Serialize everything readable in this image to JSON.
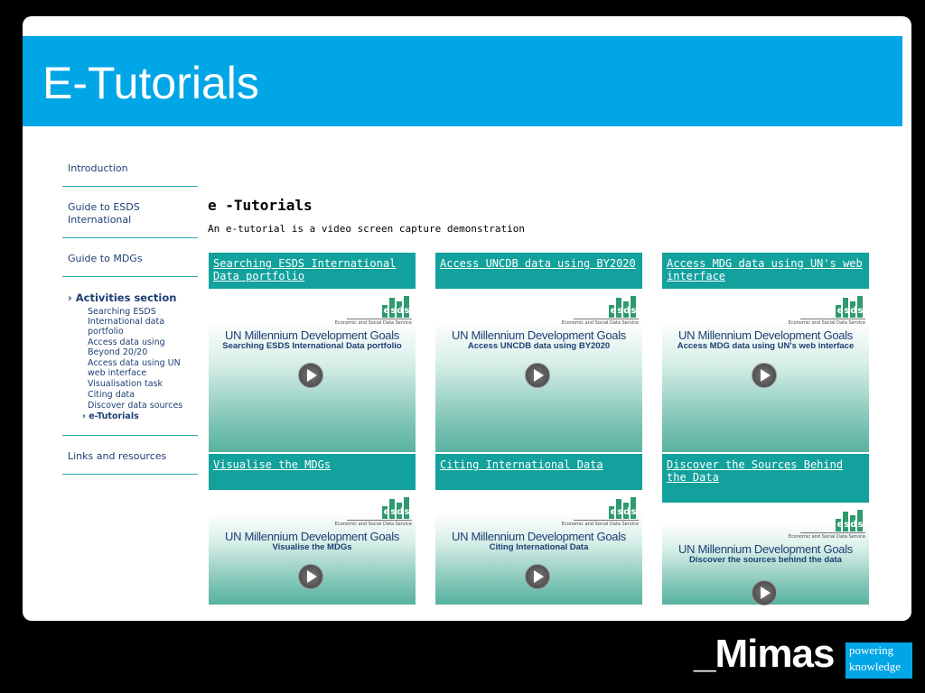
{
  "title": "E-Tutorials",
  "sidebar": {
    "intro": "Introduction",
    "guide_esds": "Guide to ESDS International",
    "guide_mdgs": "Guide to MDGs",
    "activities": "Activities section",
    "sub": [
      "Searching ESDS International data portfolio",
      "Access data using Beyond 20/20",
      "Access data using UN web interface",
      "Visualisation task",
      "Citing data",
      "Discover data sources"
    ],
    "current": "e-Tutorials",
    "links": "Links and resources"
  },
  "main": {
    "heading": "e -Tutorials",
    "description": "An e-tutorial is a video screen capture demonstration"
  },
  "cards": [
    {
      "title": "Searching ESDS International Data portfolio",
      "heading": "UN Millennium Development Goals",
      "subtitle": "Searching ESDS International Data portfolio"
    },
    {
      "title": "Access UNCDB data using BY2020",
      "heading": "UN Millennium Development Goals",
      "subtitle": "Access UNCDB data using BY2020"
    },
    {
      "title": "Access MDG data using UN's web interface",
      "heading": "UN Millennium Development Goals",
      "subtitle": "Access MDG data using UN's web interface"
    },
    {
      "title": "Visualise the MDGs",
      "heading": "UN Millennium Development Goals",
      "subtitle": "Visualise the MDGs"
    },
    {
      "title": "Citing International Data",
      "heading": "UN Millennium Development Goals",
      "subtitle": "Citing International Data"
    },
    {
      "title": "Discover the Sources Behind the Data",
      "heading": "UN Millennium Development Goals",
      "subtitle": "Discover the sources behind the data"
    }
  ],
  "esds": {
    "logo": "esds",
    "caption": "Economic and Social Data Service"
  },
  "brand": {
    "name": "_Mimas",
    "tag1": "powering",
    "tag2": "knowledge"
  },
  "colors": {
    "accent": "#00a6e6",
    "teal": "#12a19c",
    "navy": "#1d3f74"
  }
}
